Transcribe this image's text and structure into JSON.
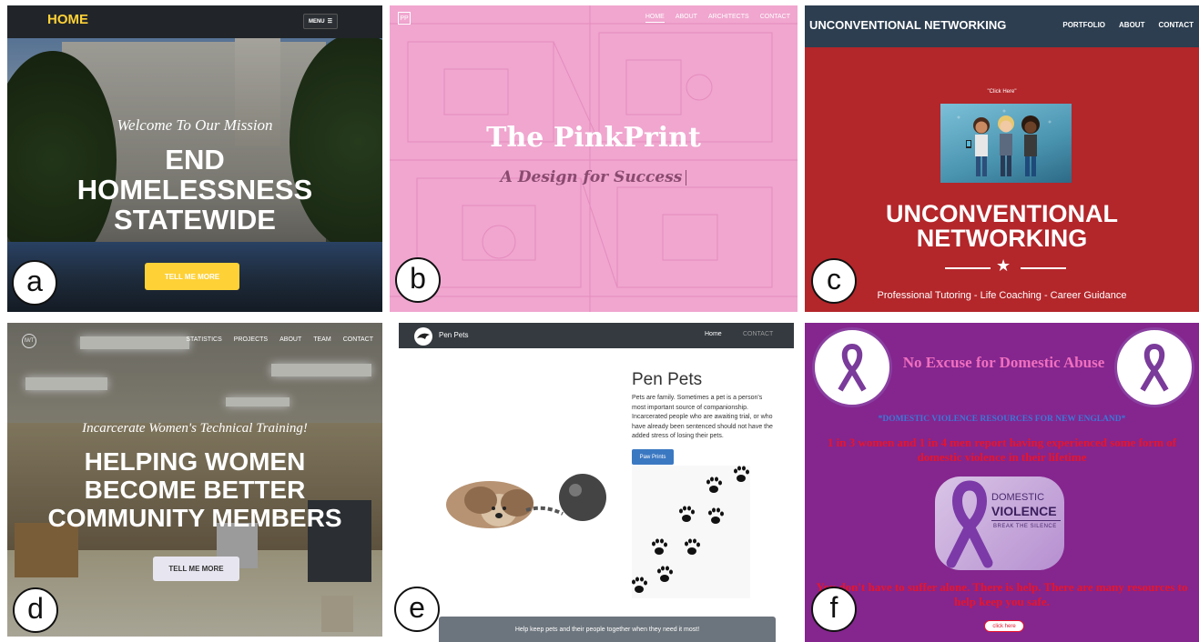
{
  "labels": {
    "a": "a",
    "b": "b",
    "c": "c",
    "d": "d",
    "e": "e",
    "f": "f"
  },
  "panel_a": {
    "brand": "HOME",
    "menu_label": "MENU",
    "menu_glyph": "☰",
    "welcome": "Welcome To Our Mission",
    "headline": [
      "END",
      "HOMELESSNESS",
      "STATEWIDE"
    ],
    "cta": "TELL ME MORE"
  },
  "panel_b": {
    "logo": "PP",
    "nav": [
      "HOME",
      "ABOUT",
      "ARCHITECTS",
      "CONTACT"
    ],
    "title": "The PinkPrint",
    "subtitle": "A Design for Success"
  },
  "panel_c": {
    "brand": "UNCONVENTIONAL NETWORKING",
    "nav": [
      "PORTFOLIO",
      "ABOUT",
      "CONTACT"
    ],
    "click_here": "\"Click Here\"",
    "headline": [
      "UNCONVENTIONAL",
      "NETWORKING"
    ],
    "star_glyph": "★",
    "tagline": "Professional Tutoring - Life Coaching - Career Guidance"
  },
  "panel_d": {
    "logo": "IWT",
    "nav": [
      "STATISTICS",
      "PROJECTS",
      "ABOUT",
      "TEAM",
      "CONTACT"
    ],
    "italic_title": "Incarcerate Women's Technical Training!",
    "headline": [
      "HELPING WOMEN",
      "BECOME BETTER",
      "COMMUNITY MEMBERS"
    ],
    "cta": "TELL ME MORE"
  },
  "panel_e": {
    "brand": "Pen Pets",
    "nav_home": "Home",
    "nav_contact": "CONTACT",
    "heading": "Pen Pets",
    "body": "Pets are family. Sometimes a pet is a person's most important source of companionship. Incarcerated people who are awaiting trial, or who have already been sentenced should not have the added stress of losing their pets.",
    "button": "Paw Prints",
    "footer": "Help keep pets and their people together when they need it most!"
  },
  "panel_f": {
    "title": "No Excuse for Domestic Abuse",
    "resources": "*DOMESTIC VIOLENCE RESOURCES FOR NEW ENGLAND*",
    "stat": "1 in 3 women and 1 in 4 men report having experienced some form of domestic violence in their lifetime",
    "dv_line1": "DOMESTIC",
    "dv_line2": "VIOLENCE",
    "dv_line3": "BREAK THE SILENCE",
    "help": "You don't have to suffer alone. There is help. There are many resources to help keep you safe.",
    "button": "click here"
  },
  "colors": {
    "accent_yellow": "#fed136",
    "pink_bg": "#f0a6cf",
    "red_bg": "#b3262a",
    "navy_nav": "#2c3e50",
    "purple_bg": "#84268e",
    "alert_red": "#e8142c"
  }
}
